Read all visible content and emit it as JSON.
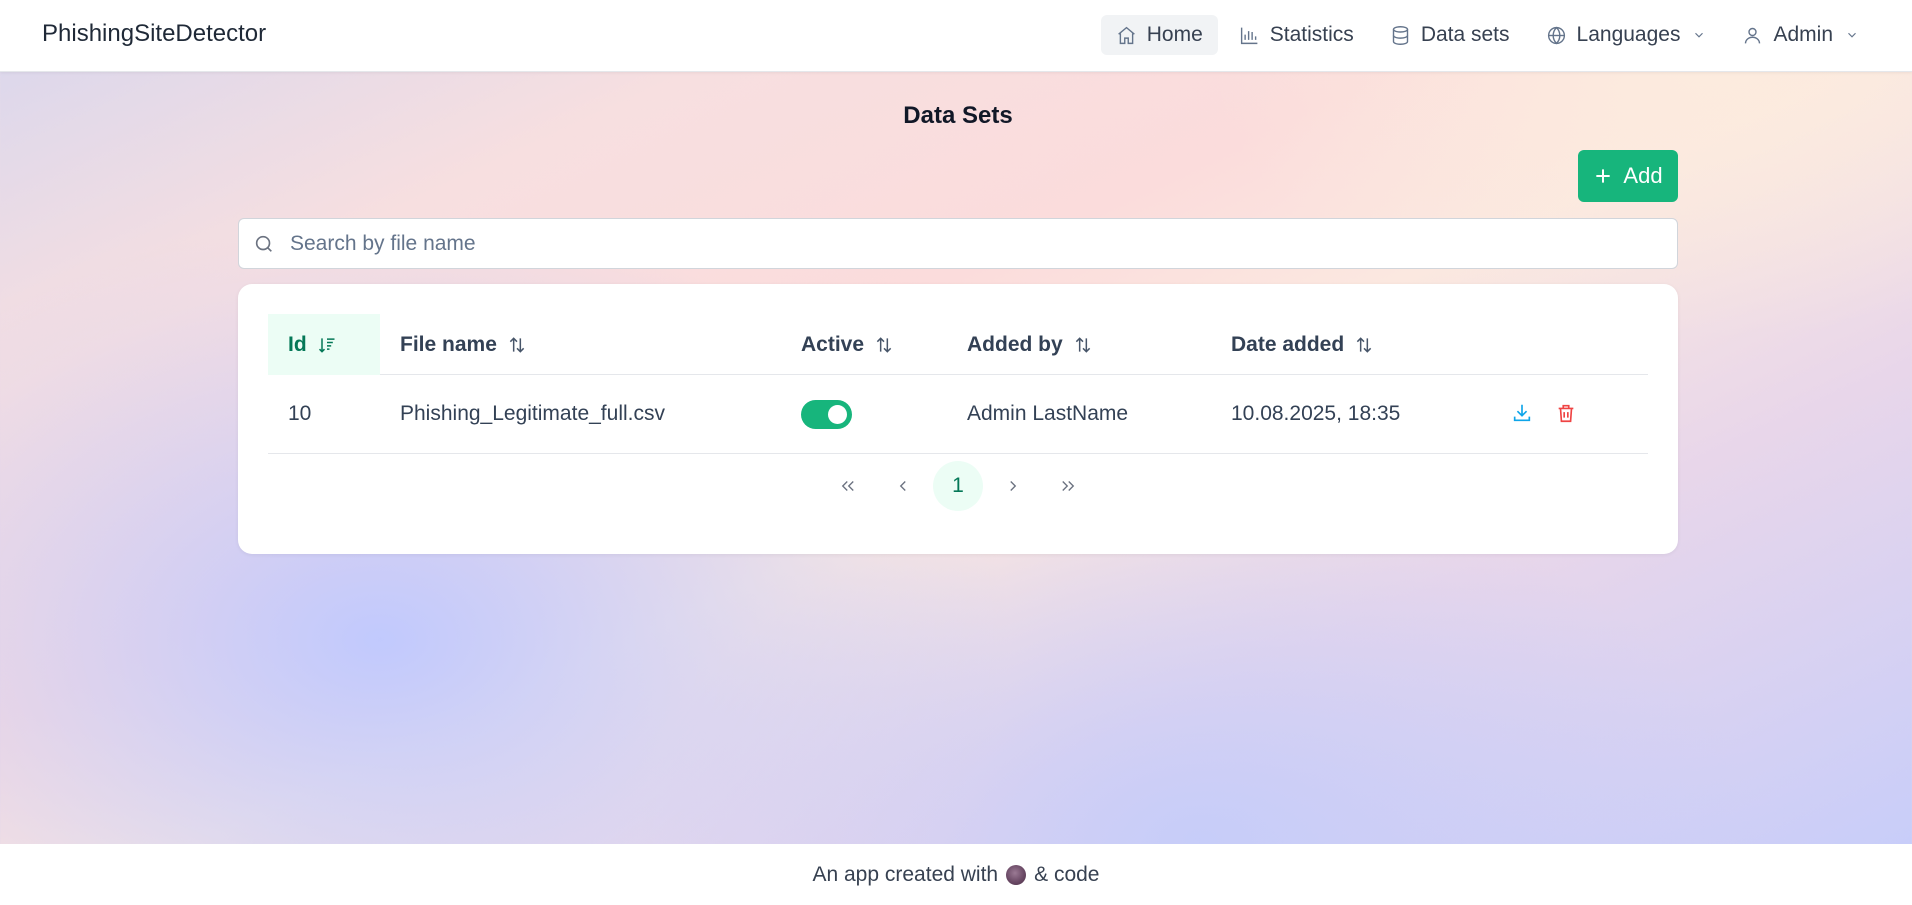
{
  "app": {
    "brand": "PhishingSiteDetector"
  },
  "nav": {
    "home": "Home",
    "statistics": "Statistics",
    "datasets": "Data sets",
    "languages": "Languages",
    "admin": "Admin"
  },
  "page": {
    "title": "Data Sets"
  },
  "toolbar": {
    "add_label": "Add"
  },
  "search": {
    "placeholder": "Search by file name",
    "value": ""
  },
  "table": {
    "columns": [
      "Id",
      "File name",
      "Active",
      "Added by",
      "Date added"
    ],
    "sorted_column": "Id",
    "rows": [
      {
        "id": "10",
        "file_name": "Phishing_Legitimate_full.csv",
        "active": true,
        "added_by": "Admin LastName",
        "date_added": "10.08.2025, 18:35"
      }
    ]
  },
  "pagination": {
    "current": "1"
  },
  "footer": {
    "text_before": "An app created with",
    "text_after": "& code"
  },
  "colors": {
    "accent": "#17b57c",
    "download": "#0ea5e9",
    "delete": "#ef4444"
  }
}
